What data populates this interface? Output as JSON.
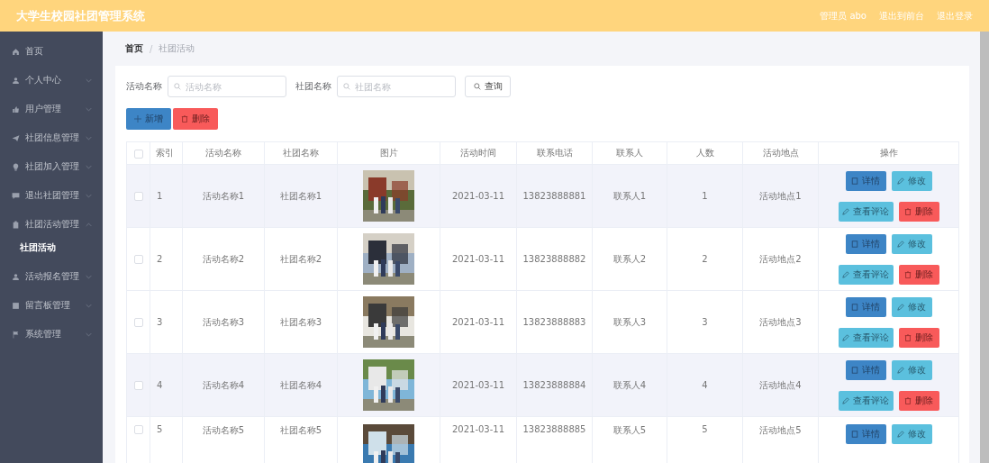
{
  "header": {
    "title": "大学生校园社团管理系统",
    "links": [
      "管理员 abo",
      "退出到前台",
      "退出登录"
    ]
  },
  "sidebar": {
    "items": [
      {
        "label": "首页",
        "kind": "home"
      },
      {
        "label": "个人中心",
        "kind": "user",
        "expanded": false
      },
      {
        "label": "用户管理",
        "kind": "thumb",
        "expanded": false
      },
      {
        "label": "社团信息管理",
        "kind": "plane",
        "expanded": false
      },
      {
        "label": "社团加入管理",
        "kind": "bulb",
        "expanded": false
      },
      {
        "label": "退出社团管理",
        "kind": "chat",
        "expanded": false
      },
      {
        "label": "社团活动管理",
        "kind": "clipboard",
        "expanded": true,
        "children": [
          {
            "label": "社团活动",
            "selected": true
          }
        ]
      },
      {
        "label": "活动报名管理",
        "kind": "user",
        "expanded": false
      },
      {
        "label": "留言板管理",
        "kind": "check",
        "expanded": false
      },
      {
        "label": "系统管理",
        "kind": "flag",
        "expanded": false
      }
    ]
  },
  "breadcrumb": [
    "首页",
    "社团活动"
  ],
  "breadcrumb_separator": "/",
  "search": {
    "fields": [
      {
        "label": "活动名称",
        "placeholder": "活动名称"
      },
      {
        "label": "社团名称",
        "placeholder": "社团名称"
      }
    ],
    "button": "查询"
  },
  "toolbar": [
    {
      "label": "新增",
      "kind": "add"
    },
    {
      "label": "删除",
      "kind": "delete"
    }
  ],
  "table": {
    "select_all_checked": false,
    "columns": [
      "索引",
      "活动名称",
      "社团名称",
      "图片",
      "活动时间",
      "联系电话",
      "联系人",
      "人数",
      "活动地点",
      "操作"
    ],
    "rows": [
      {
        "checked": false,
        "highlighted": true,
        "cells": [
          "1",
          "活动名称1",
          "社团名称1",
          {
            "kind": "picture"
          },
          "2021-03-11",
          "13823888881",
          "联系人1",
          "1",
          "活动地点1"
        ],
        "actions": [
          {
            "label": "详情",
            "kind": "detail"
          },
          {
            "label": "修改",
            "kind": "edit"
          },
          {
            "label": "查看评论",
            "kind": "comment"
          },
          {
            "label": "删除",
            "kind": "delete"
          }
        ]
      },
      {
        "checked": false,
        "highlighted": false,
        "cells": [
          "2",
          "活动名称2",
          "社团名称2",
          {
            "kind": "picture"
          },
          "2021-03-11",
          "13823888882",
          "联系人2",
          "2",
          "活动地点2"
        ],
        "actions": [
          {
            "label": "详情",
            "kind": "detail"
          },
          {
            "label": "修改",
            "kind": "edit"
          },
          {
            "label": "查看评论",
            "kind": "comment"
          },
          {
            "label": "删除",
            "kind": "delete"
          }
        ]
      },
      {
        "checked": false,
        "highlighted": false,
        "cells": [
          "3",
          "活动名称3",
          "社团名称3",
          {
            "kind": "picture"
          },
          "2021-03-11",
          "13823888883",
          "联系人3",
          "3",
          "活动地点3"
        ],
        "actions": [
          {
            "label": "详情",
            "kind": "detail"
          },
          {
            "label": "修改",
            "kind": "edit"
          },
          {
            "label": "查看评论",
            "kind": "comment"
          },
          {
            "label": "删除",
            "kind": "delete"
          }
        ]
      },
      {
        "checked": false,
        "highlighted": true,
        "cells": [
          "4",
          "活动名称4",
          "社团名称4",
          {
            "kind": "picture"
          },
          "2021-03-11",
          "13823888884",
          "联系人4",
          "4",
          "活动地点4"
        ],
        "actions": [
          {
            "label": "详情",
            "kind": "detail"
          },
          {
            "label": "修改",
            "kind": "edit"
          },
          {
            "label": "查看评论",
            "kind": "comment"
          },
          {
            "label": "删除",
            "kind": "delete"
          }
        ]
      },
      {
        "checked": false,
        "highlighted": false,
        "cells": [
          "5",
          "活动名称5",
          "社团名称5",
          {
            "kind": "picture"
          },
          "2021-03-11",
          "13823888885",
          "联系人5",
          "5",
          "活动地点5"
        ],
        "actions": [
          {
            "label": "详情",
            "kind": "detail"
          },
          {
            "label": "修改",
            "kind": "edit"
          }
        ]
      }
    ]
  }
}
